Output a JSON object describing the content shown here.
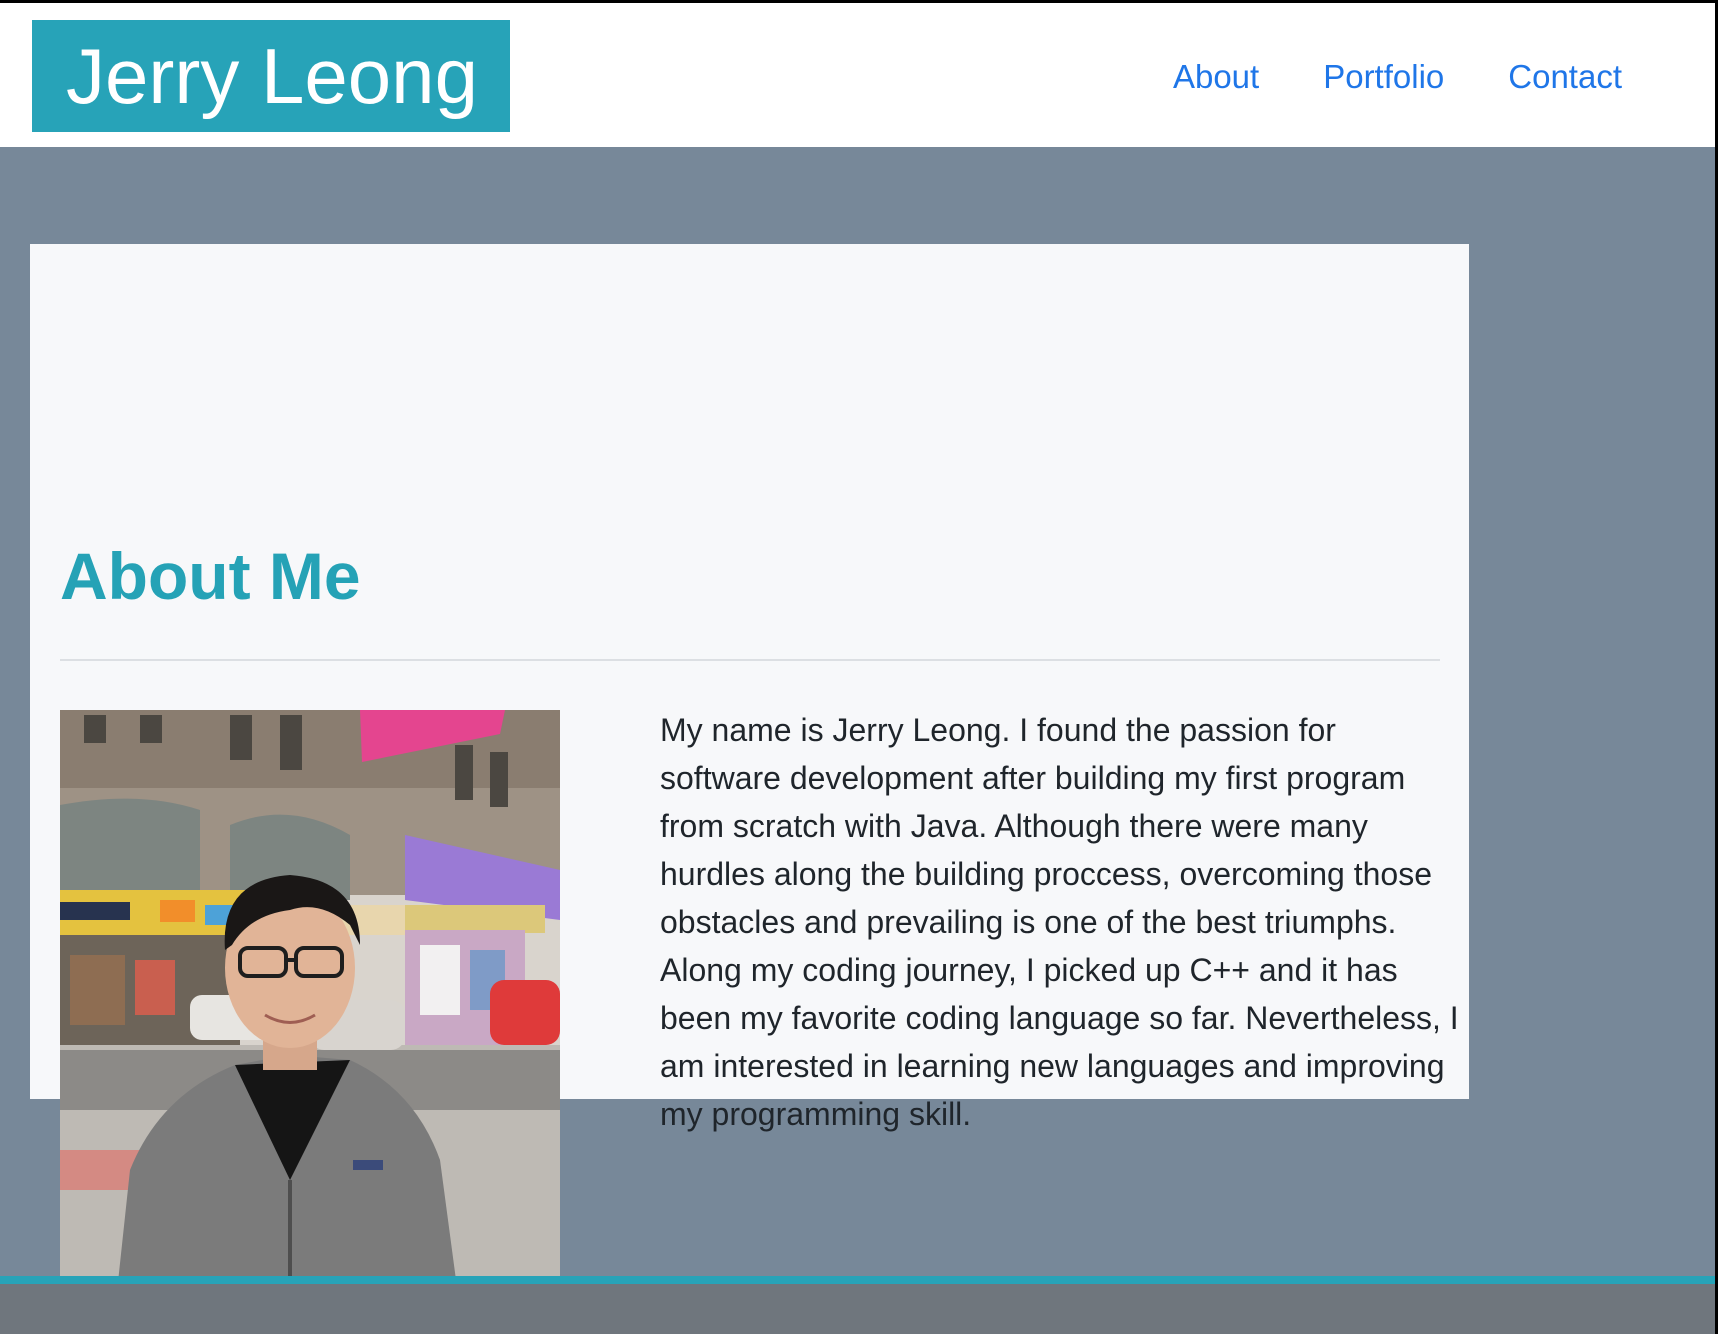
{
  "brand": {
    "name": "Jerry Leong"
  },
  "nav": {
    "items": [
      {
        "label": "About"
      },
      {
        "label": "Portfolio"
      },
      {
        "label": "Contact"
      }
    ]
  },
  "about": {
    "title": "About Me",
    "bio": "My name is Jerry Leong. I found the passion for software development after building my first program from scratch with Java. Although there were many hurdles along the building proccess, overcoming those obstacles and prevailing is one of the best triumphs. Along my coding journey, I picked up C++ and it has been my favorite coding language so far. Nevertheless, I am interested in learning new languages and improving my programming skill."
  },
  "colors": {
    "brand": "#27a3b8",
    "link": "#1f76e8",
    "page_background": "#778899",
    "card_background": "#f7f8fa",
    "footer": "#6f767d"
  }
}
